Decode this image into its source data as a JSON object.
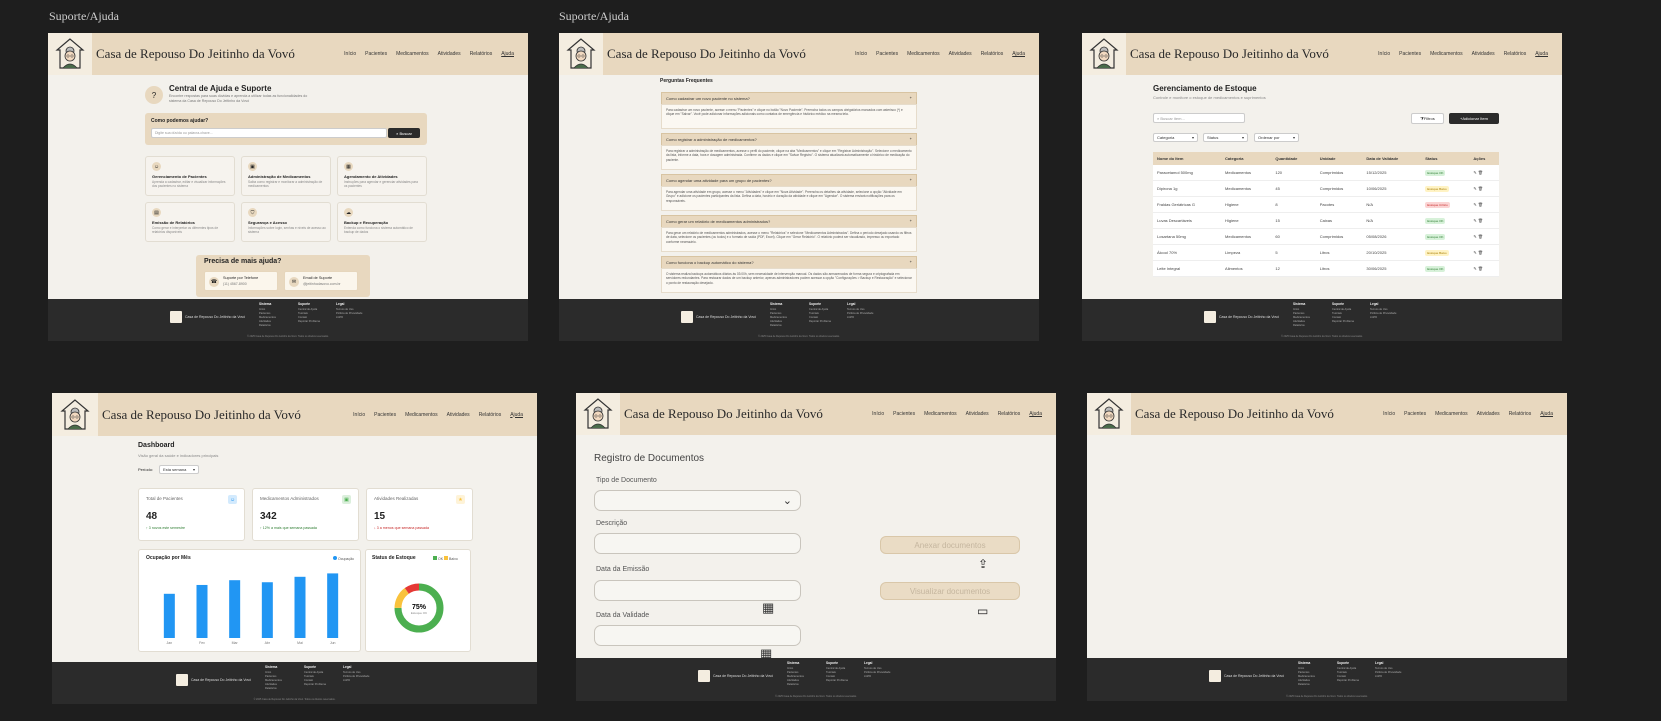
{
  "frame_titles": [
    "Suporte/Ajuda",
    "Suporte/Ajuda"
  ],
  "brand": "Casa de Repouso Do Jeitinho da Vovó",
  "nav": [
    "Início",
    "Pacientes",
    "Medicamentos",
    "Atividades",
    "Relatórios",
    "Ajuda"
  ],
  "footer": {
    "brand_small": "Casa de Repouso Do Jeitinho da Vovó",
    "cols": [
      {
        "title": "Sistema",
        "items": [
          "Início",
          "Pacientes",
          "Medicamentos",
          "Atividades",
          "Relatórios"
        ]
      },
      {
        "title": "Suporte",
        "items": [
          "Central de Ajuda",
          "Tutoriais",
          "Contato",
          "Reportar Problema"
        ]
      },
      {
        "title": "Legal",
        "items": [
          "Termos de Uso",
          "Política de Privacidade",
          "LGPD"
        ]
      }
    ],
    "copyright": "© 2025 Casa de Repouso Do Jeitinho da Vovó. Todos os direitos reservados."
  },
  "help": {
    "title": "Central de Ajuda e Suporte",
    "subtitle": "Encontre respostas para suas dúvidas e aprenda a utilizar todas as funcionalidades do sistema da Casa de Repouso Do Jeitinho da Vovó",
    "search_title": "Como podemos ajudar?",
    "search_placeholder": "Digite sua dúvida ou palavra-chave...",
    "search_button": "Buscar",
    "topics": [
      {
        "title": "Gerenciamento de Pacientes",
        "desc": "Aprenda a cadastrar, editar e visualizar informações dos pacientes no sistema",
        "icon": "user-icon"
      },
      {
        "title": "Administração de Medicamentos",
        "desc": "Saiba como registrar e monitorar a administração de medicamentos",
        "icon": "pill-icon"
      },
      {
        "title": "Agendamento de Atividades",
        "desc": "Instruções para agendar e gerenciar atividades para os pacientes",
        "icon": "calendar-icon"
      },
      {
        "title": "Emissão de Relatórios",
        "desc": "Como gerar e interpretar os diferentes tipos de relatórios disponíveis",
        "icon": "report-icon"
      },
      {
        "title": "Segurança e Acesso",
        "desc": "Informações sobre login, senhas e níveis de acesso ao sistema",
        "icon": "shield-icon"
      },
      {
        "title": "Backup e Recuperação",
        "desc": "Entenda como funciona o sistema automático de backup de dados",
        "icon": "cloud-icon"
      }
    ],
    "more_title": "Precisa de mais ajuda?",
    "phone_label": "Suporte por Telefone",
    "phone_value": "(11) 4567-8900",
    "email_label": "Email de Suporte",
    "email_value": "@jeitinhodavovo.com.br"
  },
  "faq": {
    "title": "Perguntas Frequentes",
    "items": [
      {
        "q": "Como cadastrar um novo paciente no sistema?",
        "a": "Para cadastrar um novo paciente, acesse o menu \"Pacientes\" e clique no botão \"Novo Paciente\". Preencha todos os campos obrigatórios marcados com asterisco (*) e clique em \"Salvar\". Você pode adicionar informações adicionais como contatos de emergência e histórico médico na mesma tela."
      },
      {
        "q": "Como registrar a administração de medicamentos?",
        "a": "Para registrar a administração de medicamentos, acesse o perfil do paciente, clique na aba \"Medicamentos\" e clique em \"Registrar Administração\". Selecione o medicamento da lista, informe a data, hora e dosagem administrada. Confirme os dados e clique em \"Salvar Registro\". O sistema atualizará automaticamente o histórico de medicação do paciente."
      },
      {
        "q": "Como agendar uma atividade para um grupo de pacientes?",
        "a": "Para agendar uma atividade em grupo, acesse o menu \"Atividades\" e clique em \"Nova Atividade\". Preencha os detalhes da atividade, selecione a opção \"Atividade em Grupo\" e adicione os pacientes participantes da lista. Defina a data, horário e duração da atividade e clique em \"Agendar\". O sistema enviará notificações para os responsáveis."
      },
      {
        "q": "Como gerar um relatório de medicamentos administrados?",
        "a": "Para gerar um relatório de medicamentos administrados, acesse o menu \"Relatórios\" e selecione \"Medicamentos Administrados\". Defina o período desejado usando os filtros de data, selecione os pacientes (ou todos) e o formato de saída (PDF, Excel). Clique em \"Gerar Relatório\". O relatório poderá ser visualizado, impresso ou exportado conforme necessário."
      },
      {
        "q": "Como funciona o backup automático do sistema?",
        "a": "O sistema realiza backups automáticos diários às 03:00h, sem necessidade de intervenção manual. Os dados são armazenados de forma segura e criptografada em servidores redundantes. Para restaurar dados de um backup anterior, apenas administradores podem acessar a opção \"Configurações > Backup e Restauração\" e selecionar o ponto de restauração desejado."
      }
    ]
  },
  "stock": {
    "title": "Gerenciamento de Estoque",
    "subtitle": "Controle e monitore o estoque de medicamentos e suprimentos",
    "search_placeholder": "Buscar item...",
    "filter_button": "Filtros",
    "add_button": "Adicionar Item",
    "selects": [
      "Categoria",
      "Status",
      "Ordenar por"
    ],
    "columns": [
      "Nome do Item",
      "Categoria",
      "Quantidade",
      "Unidade",
      "Data de Validade",
      "Status",
      "Ações"
    ],
    "rows": [
      [
        "Paracetamol 500mg",
        "Medicamentos",
        "120",
        "Comprimidos",
        "15/12/2025",
        "Estoque OK"
      ],
      [
        "Dipirona 1g",
        "Medicamentos",
        "45",
        "Comprimidos",
        "10/06/2025",
        "Estoque Baixo"
      ],
      [
        "Fraldas Geriátricas G",
        "Higiene",
        "8",
        "Pacotes",
        "N/A",
        "Estoque Crítico"
      ],
      [
        "Luvas Descartáveis",
        "Higiene",
        "15",
        "Caixas",
        "N/A",
        "Estoque OK"
      ],
      [
        "Losartana 50mg",
        "Medicamentos",
        "60",
        "Comprimidos",
        "05/08/2026",
        "Estoque OK"
      ],
      [
        "Álcool 70%",
        "Limpeza",
        "5",
        "Litros",
        "20/10/2025",
        "Estoque Baixo"
      ],
      [
        "Leite Integral",
        "Alimentos",
        "12",
        "Litros",
        "30/06/2025",
        "Estoque OK"
      ]
    ]
  },
  "dashboard": {
    "title": "Dashboard",
    "subtitle": "Visão geral da saúde e indicadores principais",
    "period_label": "Período:",
    "period_value": "Esta semana",
    "kpis": [
      {
        "label": "Total de Pacientes",
        "value": "48",
        "trend": "↑ 3 novos este semestre",
        "color": "#2e7d32",
        "icon": "user-icon"
      },
      {
        "label": "Medicamentos Administrados",
        "value": "342",
        "trend": "↑ 12% a mais que semana passada",
        "color": "#2e7d32",
        "icon": "pill-icon"
      },
      {
        "label": "Atividades Realizadas",
        "value": "15",
        "trend": "↓ 3 a menos que semana passada",
        "color": "#c62828",
        "icon": "star-icon"
      }
    ],
    "chart_title": "Ocupação por Mês",
    "legend": "Ocupação",
    "donut_title": "Status de Estoque",
    "donut_legend": [
      "OK",
      "Baixo"
    ],
    "donut_pct": "75%",
    "donut_caption": "Estoque OK"
  },
  "chart_data": [
    {
      "type": "bar",
      "title": "Ocupação por Mês",
      "categories": [
        "Jan",
        "Fev",
        "Mar",
        "Abr",
        "Mai",
        "Jun"
      ],
      "values": [
        65,
        78,
        85,
        82,
        90,
        95
      ],
      "series": [
        {
          "name": "Ocupação",
          "values": [
            65,
            78,
            85,
            82,
            90,
            95
          ]
        }
      ],
      "ylim": [
        0,
        100
      ],
      "color": "#2196f3"
    },
    {
      "type": "pie",
      "title": "Status de Estoque",
      "categories": [
        "OK",
        "Baixo",
        "Crítico"
      ],
      "values": [
        75,
        15,
        10
      ],
      "colors": [
        "#4caf50",
        "#f9c23c",
        "#e53935"
      ]
    }
  ],
  "docs": {
    "title": "Registro de Documentos",
    "type_label": "Tipo de Documento",
    "desc_label": "Descrição",
    "emission_label": "Data da Emissão",
    "validity_label": "Data da Validade",
    "attach_label": "Anexar documentos",
    "view_label": "Visualizar documentos"
  },
  "colors": {
    "header": "#e8d8bf",
    "page": "#f3f1ec",
    "footer": "#2b2b2b",
    "canvas": "#1e1e1e"
  }
}
